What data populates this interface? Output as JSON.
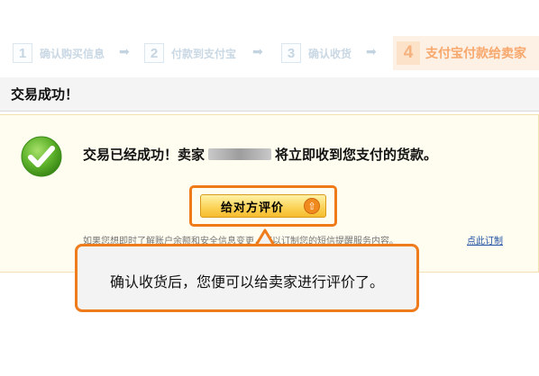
{
  "steps": [
    {
      "number": "1",
      "label": "确认购买信息"
    },
    {
      "number": "2",
      "label": "付款到支付宝"
    },
    {
      "number": "3",
      "label": "确认收货"
    }
  ],
  "active_step": {
    "number": "4",
    "label": "支付宝付款给卖家"
  },
  "title_bar": {
    "title": "交易成功！"
  },
  "panel": {
    "message_prefix": "交易已经成功！卖家",
    "message_suffix": "将立即收到您支付的货款。",
    "rate_button_label": "给对方评价",
    "notice": "如果您想即时了解账户余额和安全信息变更，可以订制您的短信提醒服务内容。",
    "subscribe_link": "点此订制"
  },
  "callout": {
    "text": "确认收货后，您便可以给卖家进行评价了。"
  },
  "colors": {
    "accent_orange": "#ee7b1c",
    "panel_bg": "#fffdef",
    "link_blue": "#1e4fa3"
  }
}
